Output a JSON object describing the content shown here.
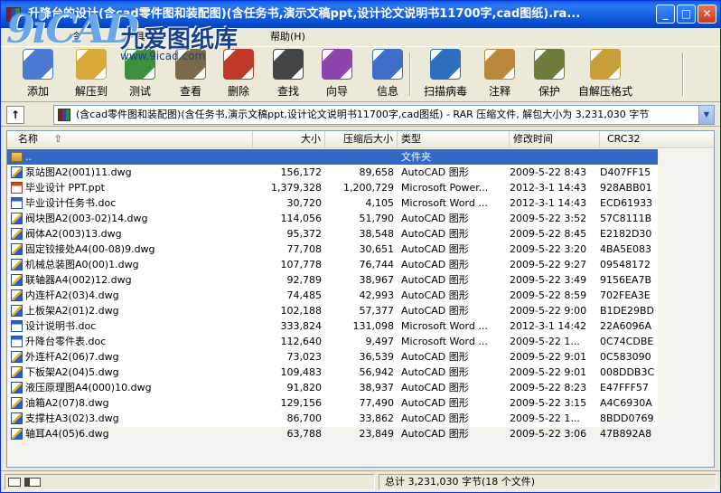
{
  "window": {
    "title": "升降台的设计(含cad零件图和装配图)(含任务书,演示文稿ppt,设计论文说明书11700字,cad图纸).ra...",
    "buttons": {
      "minimize": "_",
      "maximize": "□",
      "close": "✕"
    }
  },
  "watermark": {
    "brand": "9iCAD",
    "name": "九爱图纸库",
    "url": "www.9icad.com"
  },
  "menu": {
    "items": [
      "令",
      "具",
      "帮助(H)"
    ]
  },
  "toolbar": {
    "buttons": [
      {
        "label": "添加",
        "icon": "books-icon",
        "color": "#4a7bd0"
      },
      {
        "label": "解压到",
        "icon": "folder-extract-icon",
        "color": "#d6a93a"
      },
      {
        "label": "测试",
        "icon": "test-check-icon",
        "color": "#3d8f3d"
      },
      {
        "label": "查看",
        "icon": "view-book-icon",
        "color": "#7a6a4a"
      },
      {
        "label": "删除",
        "icon": "delete-icon",
        "color": "#c0392b"
      },
      {
        "label": "查找",
        "icon": "binoculars-icon",
        "color": "#444444"
      },
      {
        "label": "向导",
        "icon": "wizard-icon",
        "color": "#8e44ad"
      },
      {
        "label": "信息",
        "icon": "info-icon",
        "color": "#3d6fc9"
      },
      {
        "label": "扫描病毒",
        "icon": "virus-scan-icon",
        "color": "#2e6fc0"
      },
      {
        "label": "注释",
        "icon": "comment-icon",
        "color": "#b8893a"
      },
      {
        "label": "保护",
        "icon": "shield-icon",
        "color": "#6d7b3b"
      },
      {
        "label": "自解压格式",
        "icon": "sfx-archive-icon",
        "color": "#c7a03a"
      }
    ]
  },
  "address": {
    "up_label": "↑",
    "text": "(含cad零件图和装配图)(含任务书,演示文稿ppt,设计论文说明书11700字,cad图纸) - RAR 压缩文件, 解包大小为 3,231,030 字节"
  },
  "columns": {
    "name": "名称",
    "name_sort": "⇧",
    "size": "大小",
    "packed": "压缩后大小",
    "type": "类型",
    "modified": "修改时间",
    "crc": "CRC32"
  },
  "parent_row": {
    "name": "..",
    "type": "文件夹"
  },
  "files": [
    {
      "name": "泵站图A2(001)11.dwg",
      "size": "156,172",
      "packed": "89,658",
      "type": "AutoCAD 图形",
      "modified": "2009-5-22 8:43",
      "crc": "D407FF15",
      "kind": "dwg"
    },
    {
      "name": "毕业设计 PPT.ppt",
      "size": "1,379,328",
      "packed": "1,200,729",
      "type": "Microsoft Power...",
      "modified": "2012-3-1 14:43",
      "crc": "928ABB01",
      "kind": "ppt"
    },
    {
      "name": "毕业设计任务书.doc",
      "size": "30,720",
      "packed": "4,105",
      "type": "Microsoft Word ...",
      "modified": "2012-3-1 14:43",
      "crc": "ECD61933",
      "kind": "doc"
    },
    {
      "name": "阀块图A2(003-02)14.dwg",
      "size": "114,056",
      "packed": "51,790",
      "type": "AutoCAD 图形",
      "modified": "2009-5-22 3:52",
      "crc": "57C8111B",
      "kind": "dwg"
    },
    {
      "name": "阀体A2(003)13.dwg",
      "size": "95,372",
      "packed": "38,548",
      "type": "AutoCAD 图形",
      "modified": "2009-5-22 8:45",
      "crc": "E2182D30",
      "kind": "dwg"
    },
    {
      "name": "固定铰接处A4(00-08)9.dwg",
      "size": "77,708",
      "packed": "30,651",
      "type": "AutoCAD 图形",
      "modified": "2009-5-22 3:20",
      "crc": "4BA5E083",
      "kind": "dwg"
    },
    {
      "name": "机械总装图A0(00)1.dwg",
      "size": "107,778",
      "packed": "76,744",
      "type": "AutoCAD 图形",
      "modified": "2009-5-22 9:27",
      "crc": "09548172",
      "kind": "dwg"
    },
    {
      "name": "联轴器A4(002)12.dwg",
      "size": "92,789",
      "packed": "38,967",
      "type": "AutoCAD 图形",
      "modified": "2009-5-22 3:49",
      "crc": "9156EA7B",
      "kind": "dwg"
    },
    {
      "name": "内连杆A2(03)4.dwg",
      "size": "74,485",
      "packed": "42,993",
      "type": "AutoCAD 图形",
      "modified": "2009-5-22 8:59",
      "crc": "702FEA3E",
      "kind": "dwg"
    },
    {
      "name": "上板架A2(01)2.dwg",
      "size": "102,188",
      "packed": "57,377",
      "type": "AutoCAD 图形",
      "modified": "2009-5-22 9:00",
      "crc": "B1DE29BD",
      "kind": "dwg"
    },
    {
      "name": "设计说明书.doc",
      "size": "333,824",
      "packed": "131,098",
      "type": "Microsoft Word ...",
      "modified": "2012-3-1 14:42",
      "crc": "22A6096A",
      "kind": "doc"
    },
    {
      "name": "升降台零件表.doc",
      "size": "112,640",
      "packed": "9,497",
      "type": "Microsoft Word ...",
      "modified": "2009-5-22 1...",
      "crc": "0C74CDBE",
      "kind": "doc"
    },
    {
      "name": "外连杆A2(06)7.dwg",
      "size": "73,023",
      "packed": "36,539",
      "type": "AutoCAD 图形",
      "modified": "2009-5-22 9:01",
      "crc": "0C583090",
      "kind": "dwg"
    },
    {
      "name": "下板架A2(04)5.dwg",
      "size": "109,483",
      "packed": "56,942",
      "type": "AutoCAD 图形",
      "modified": "2009-5-22 9:01",
      "crc": "008DDB3C",
      "kind": "dwg"
    },
    {
      "name": "液压原理图A4(000)10.dwg",
      "size": "91,820",
      "packed": "38,937",
      "type": "AutoCAD 图形",
      "modified": "2009-5-22 8:23",
      "crc": "E47FFF57",
      "kind": "dwg"
    },
    {
      "name": "油箱A2(07)8.dwg",
      "size": "129,156",
      "packed": "77,490",
      "type": "AutoCAD 图形",
      "modified": "2009-5-22 3:15",
      "crc": "A4C6930A",
      "kind": "dwg"
    },
    {
      "name": "支撑柱A3(02)3.dwg",
      "size": "86,700",
      "packed": "33,862",
      "type": "AutoCAD 图形",
      "modified": "2009-5-22 1...",
      "crc": "8BDD0769",
      "kind": "dwg"
    },
    {
      "name": "轴耳A4(05)6.dwg",
      "size": "63,788",
      "packed": "23,849",
      "type": "AutoCAD 图形",
      "modified": "2009-5-22 3:06",
      "crc": "47B892A8",
      "kind": "dwg"
    }
  ],
  "status": {
    "summary": "总计 3,231,030 字节(18 个文件)"
  }
}
